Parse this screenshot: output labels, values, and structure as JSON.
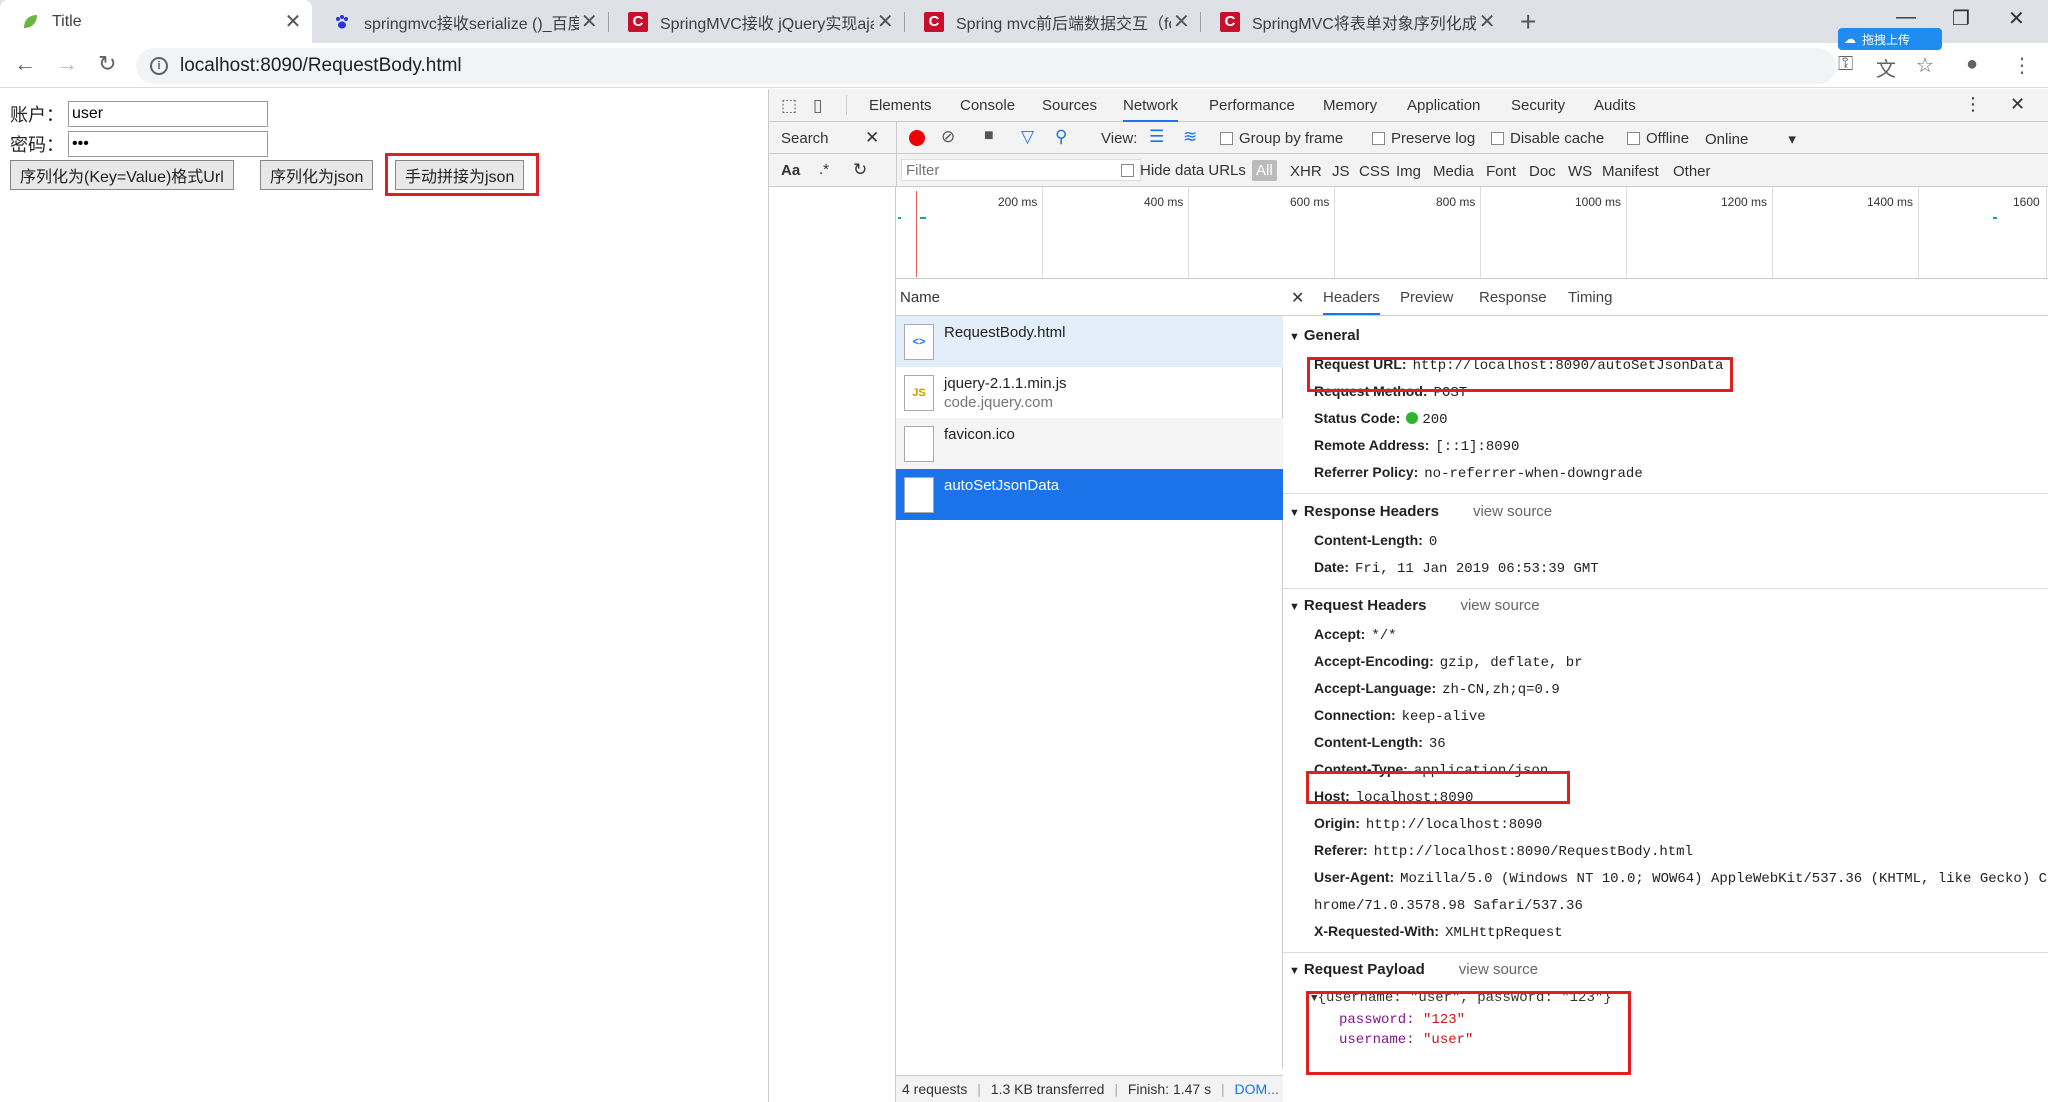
{
  "tabs": [
    {
      "title": "Title",
      "icon": "spring-leaf-icon",
      "active": true
    },
    {
      "title": "springmvc接收serialize ()_百度",
      "icon": "baidu-paw-icon"
    },
    {
      "title": "SpringMVC接收 jQuery实现aja",
      "icon": "csdn-icon"
    },
    {
      "title": "Spring mvc前后端数据交互（fo",
      "icon": "csdn-icon"
    },
    {
      "title": "SpringMVC将表单对象序列化成",
      "icon": "csdn-icon"
    }
  ],
  "toolbar": {
    "url": "localhost:8090/RequestBody.html",
    "upload_label": "拖拽上传"
  },
  "form": {
    "account_label": "账户：",
    "account_value": "user",
    "password_label": "密码：",
    "password_value": "•••",
    "btn_kv": "序列化为(Key=Value)格式Url",
    "btn_json": "序列化为json",
    "btn_manual": "手动拼接为json"
  },
  "devtools": {
    "panels": [
      "Elements",
      "Console",
      "Sources",
      "Network",
      "Performance",
      "Memory",
      "Application",
      "Security",
      "Audits"
    ],
    "active_panel": "Network",
    "search_label": "Search",
    "view_label": "View:",
    "group_by_frame": "Group by frame",
    "preserve_log": "Preserve log",
    "disable_cache": "Disable cache",
    "offline": "Offline",
    "online": "Online",
    "filter_placeholder": "Filter",
    "hide_data_urls": "Hide data URLs",
    "aa_label": "Aa",
    "regex_label": ".*",
    "filter_types": [
      "All",
      "XHR",
      "JS",
      "CSS",
      "Img",
      "Media",
      "Font",
      "Doc",
      "WS",
      "Manifest",
      "Other"
    ],
    "timeline_ticks": [
      "200 ms",
      "400 ms",
      "600 ms",
      "800 ms",
      "1000 ms",
      "1200 ms",
      "1400 ms",
      "1600"
    ],
    "name_header": "Name",
    "requests": [
      {
        "name": "RequestBody.html",
        "sub": "",
        "icon": "html-file-icon"
      },
      {
        "name": "jquery-2.1.1.min.js",
        "sub": "code.jquery.com",
        "icon": "js-file-icon"
      },
      {
        "name": "favicon.ico",
        "sub": "",
        "icon": "blank-file-icon"
      },
      {
        "name": "autoSetJsonData",
        "sub": "",
        "icon": "blank-file-icon",
        "selected": true
      }
    ],
    "status": {
      "requests": "4 requests",
      "transferred": "1.3 KB transferred",
      "finish": "Finish: 1.47 s",
      "dom": "DOM..."
    },
    "detail_tabs": [
      "Headers",
      "Preview",
      "Response",
      "Timing"
    ],
    "active_detail_tab": "Headers",
    "view_source": "view source",
    "general": {
      "title": "General",
      "rows": [
        {
          "k": "Request URL:",
          "v": "http://localhost:8090/autoSetJsonData"
        },
        {
          "k": "Request Method:",
          "v": "POST"
        },
        {
          "k": "Status Code:",
          "v": "200"
        },
        {
          "k": "Remote Address:",
          "v": "[::1]:8090"
        },
        {
          "k": "Referrer Policy:",
          "v": "no-referrer-when-downgrade"
        }
      ]
    },
    "response_headers": {
      "title": "Response Headers",
      "rows": [
        {
          "k": "Content-Length:",
          "v": "0"
        },
        {
          "k": "Date:",
          "v": "Fri, 11 Jan 2019 06:53:39 GMT"
        }
      ]
    },
    "request_headers": {
      "title": "Request Headers",
      "rows": [
        {
          "k": "Accept:",
          "v": "*/*"
        },
        {
          "k": "Accept-Encoding:",
          "v": "gzip, deflate, br"
        },
        {
          "k": "Accept-Language:",
          "v": "zh-CN,zh;q=0.9"
        },
        {
          "k": "Connection:",
          "v": "keep-alive"
        },
        {
          "k": "Content-Length:",
          "v": "36"
        },
        {
          "k": "Content-Type:",
          "v": "application/json"
        },
        {
          "k": "Host:",
          "v": "localhost:8090"
        },
        {
          "k": "Origin:",
          "v": "http://localhost:8090"
        },
        {
          "k": "Referer:",
          "v": "http://localhost:8090/RequestBody.html"
        },
        {
          "k": "User-Agent:",
          "v": "Mozilla/5.0 (Windows NT 10.0; WOW64) AppleWebKit/537.36 (KHTML, like Gecko) C"
        },
        {
          "k": "",
          "v": "hrome/71.0.3578.98 Safari/537.36"
        },
        {
          "k": "X-Requested-With:",
          "v": "XMLHttpRequest"
        }
      ]
    },
    "payload": {
      "title": "Request Payload",
      "summary": "{username: \"user\", password: \"123\"}",
      "password_key": "password:",
      "password_val": "\"123\"",
      "username_key": "username:",
      "username_val": "\"user\""
    }
  },
  "colors": {
    "highlight_red": "#e02020",
    "selected_blue": "#1a73e8",
    "status_green": "#2db52d"
  }
}
